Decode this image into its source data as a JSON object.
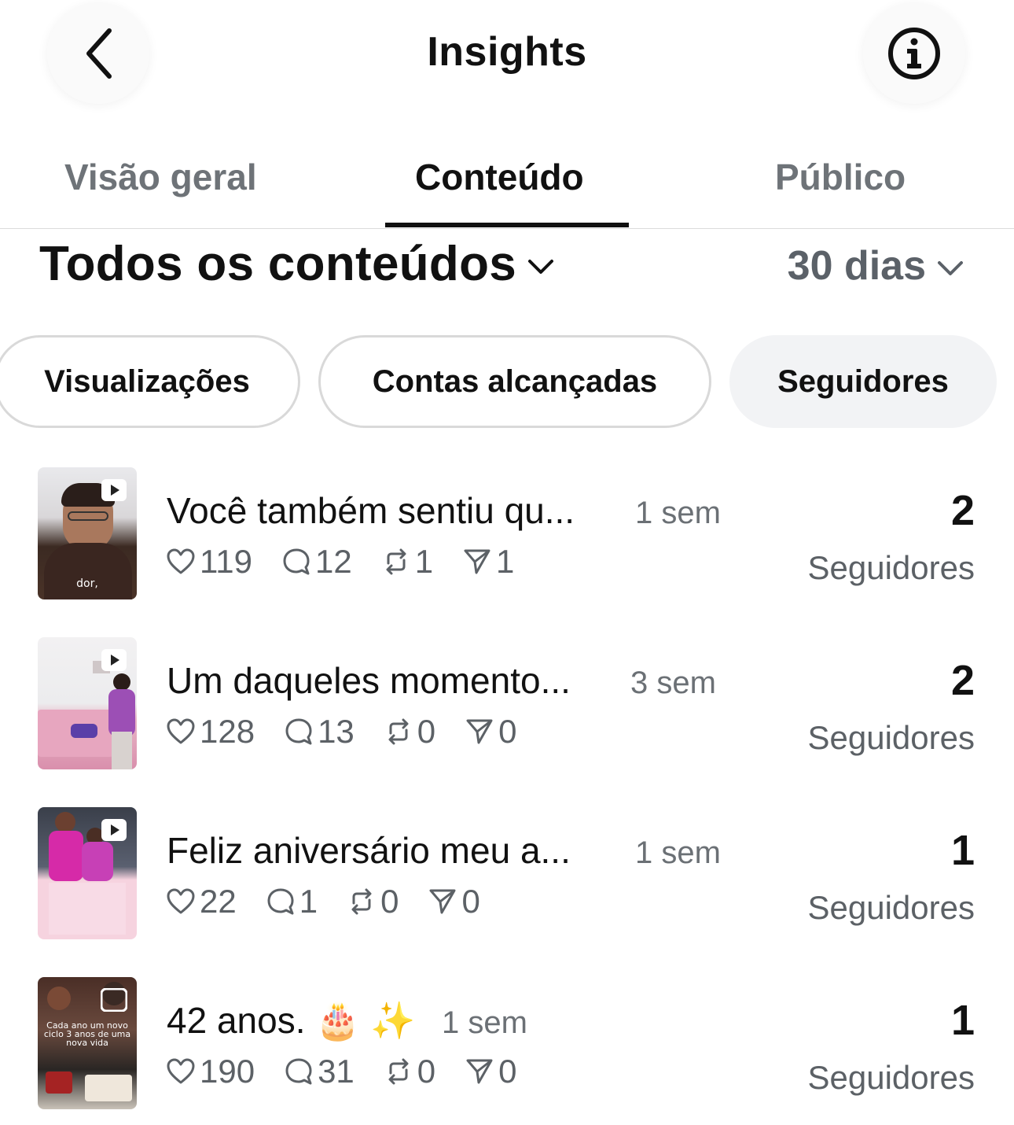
{
  "header": {
    "title": "Insights"
  },
  "tabs": [
    {
      "label": "Visão geral",
      "active": false
    },
    {
      "label": "Conteúdo",
      "active": true
    },
    {
      "label": "Público",
      "active": false
    }
  ],
  "filters": {
    "content_type": "Todos os conteúdos",
    "period": "30 dias"
  },
  "metrics": [
    {
      "label": "Visualizações",
      "selected": false
    },
    {
      "label": "Contas alcançadas",
      "selected": false
    },
    {
      "label": "Seguidores",
      "selected": true
    }
  ],
  "posts": [
    {
      "title": "Você também sentiu qu...",
      "age": "1 sem",
      "likes": "119",
      "comments": "12",
      "reposts": "1",
      "shares": "1",
      "count": "2",
      "count_label": "Seguidores",
      "thumb_caption": "dor,"
    },
    {
      "title": "Um daqueles momento...",
      "age": "3 sem",
      "likes": "128",
      "comments": "13",
      "reposts": "0",
      "shares": "0",
      "count": "2",
      "count_label": "Seguidores"
    },
    {
      "title": "Feliz aniversário meu a...",
      "age": "1 sem",
      "likes": "22",
      "comments": "1",
      "reposts": "0",
      "shares": "0",
      "count": "1",
      "count_label": "Seguidores"
    },
    {
      "title": "42 anos. 🎂 ✨",
      "age": "1 sem",
      "likes": "190",
      "comments": "31",
      "reposts": "0",
      "shares": "0",
      "count": "1",
      "count_label": "Seguidores",
      "thumb_caption": "Cada ano um novo ciclo 3 anos de uma nova vida"
    }
  ],
  "colors": {
    "text_primary": "#111111",
    "text_secondary": "#5c6166",
    "chip_selected_bg": "#f2f3f5",
    "chip_border": "#d9d9d9"
  }
}
